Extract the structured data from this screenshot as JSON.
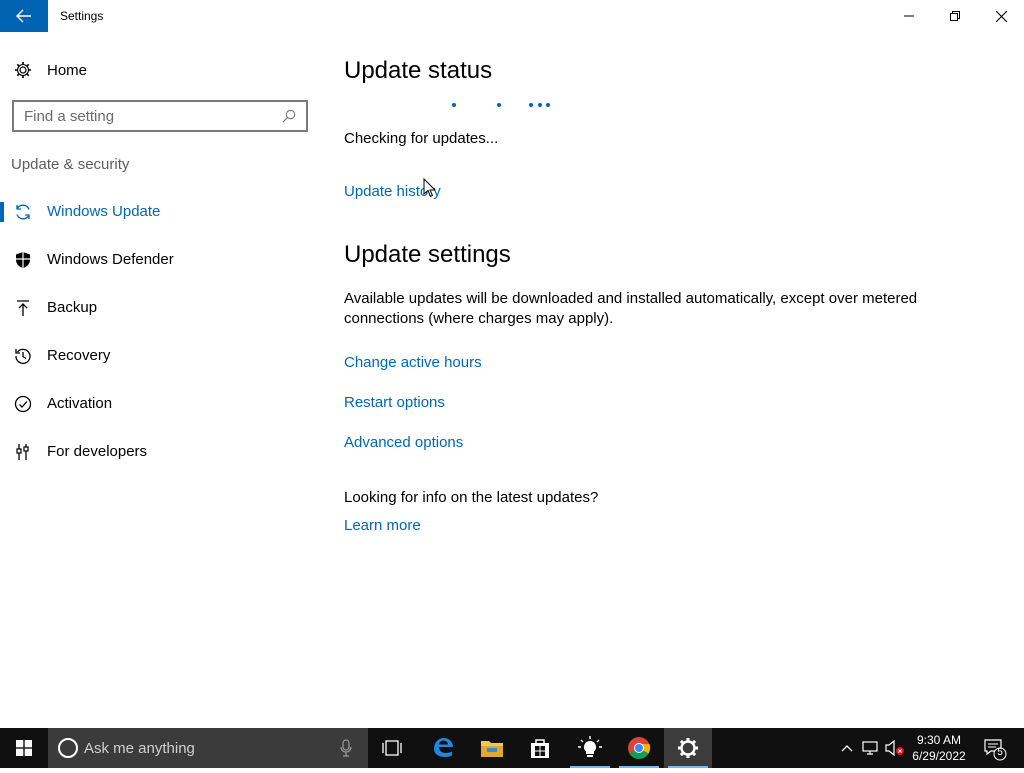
{
  "window": {
    "title": "Settings"
  },
  "sidebar": {
    "home_label": "Home",
    "search_placeholder": "Find a setting",
    "section_label": "Update & security",
    "items": [
      {
        "label": "Windows Update",
        "icon": "sync-icon",
        "active": true
      },
      {
        "label": "Windows Defender",
        "icon": "shield-icon",
        "active": false
      },
      {
        "label": "Backup",
        "icon": "backup-arrow-icon",
        "active": false
      },
      {
        "label": "Recovery",
        "icon": "history-icon",
        "active": false
      },
      {
        "label": "Activation",
        "icon": "checkmark-circle-icon",
        "active": false
      },
      {
        "label": "For developers",
        "icon": "developer-tools-icon",
        "active": false
      }
    ]
  },
  "main": {
    "update_status": {
      "heading": "Update status",
      "status_text": "Checking for updates...",
      "history_link": "Update history"
    },
    "update_settings": {
      "heading": "Update settings",
      "description": "Available updates will be downloaded and installed automatically, except over metered connections (where charges may apply).",
      "links": [
        "Change active hours",
        "Restart options",
        "Advanced options"
      ]
    },
    "info": {
      "question": "Looking for info on the latest updates?",
      "learn_more": "Learn more"
    }
  },
  "taskbar": {
    "search_placeholder": "Ask me anything",
    "time": "9:30 AM",
    "date": "6/29/2022",
    "notification_count": "5",
    "apps": [
      "task-view-icon",
      "edge-icon",
      "file-explorer-icon",
      "store-icon",
      "tips-icon",
      "chrome-icon",
      "settings-icon"
    ]
  },
  "colors": {
    "accent": "#0067b8",
    "back_button": "#0063b1",
    "taskbar": "#101010"
  }
}
